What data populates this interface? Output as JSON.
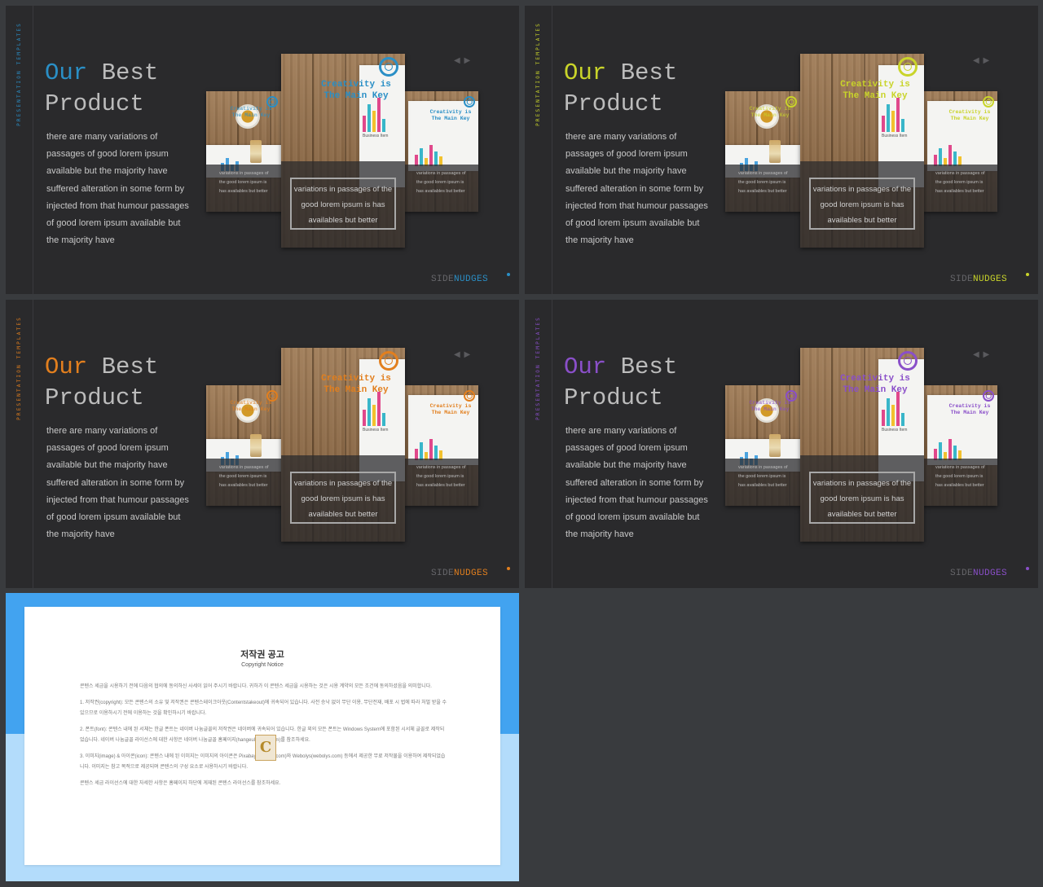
{
  "slides": [
    {
      "accent": "#2a8fc6",
      "vertical_label": "PRESENTATION TEMPLATES",
      "title_word1": "Our",
      "title_word2": "Best",
      "title_word3": "Product",
      "body": "there are many variations of passages of good lorem ipsum available but the majority have suffered alteration in some form by injected from that humour passages of good lorem ipsum available but the majority have",
      "nav_arrows": "◀ ▶",
      "center_heading": "Creativity is The Main Key",
      "side_heading": "Creativity is The Main Key",
      "center_caption": "variations in passages of the good lorem ipsum  is has availables but better",
      "side_caption": "variations in passages of the good lorem ipsum  is has availables but better",
      "paper_label": "Business Item",
      "brand_side": "SIDE",
      "brand_nudges": "NUDGES",
      "icons": [
        "target-ring-icon",
        "coffee-cup-icon",
        "bar-chart-icon",
        "left-arrow-icon",
        "right-arrow-icon"
      ]
    },
    {
      "accent": "#c9d42a",
      "vertical_label": "PRESENTATION TEMPLATES",
      "title_word1": "Our",
      "title_word2": "Best",
      "title_word3": "Product",
      "body": "there are many variations of passages of good lorem ipsum available but the majority have suffered alteration in some form by injected from that humour passages of good lorem ipsum available but the majority have",
      "nav_arrows": "◀ ▶",
      "center_heading": "Creativity is The Main Key",
      "side_heading": "Creativity is The Main Key",
      "center_caption": "variations in passages of the good lorem ipsum  is has availables but better",
      "side_caption": "variations in passages of the good lorem ipsum  is has availables but better",
      "paper_label": "Business Item",
      "brand_side": "SIDE",
      "brand_nudges": "NUDGES"
    },
    {
      "accent": "#e27f1e",
      "vertical_label": "PRESENTATION TEMPLATES",
      "title_word1": "Our",
      "title_word2": "Best",
      "title_word3": "Product",
      "body": "there are many variations of passages of good lorem ipsum available but the majority have suffered alteration in some form by injected from that humour passages of good lorem ipsum available but the majority have",
      "nav_arrows": "◀ ▶",
      "center_heading": "Creativity is The Main Key",
      "side_heading": "Creativity is The Main Key",
      "center_caption": "variations in passages of the good lorem ipsum  is has availables but better",
      "side_caption": "variations in passages of the good lorem ipsum  is has availables but better",
      "paper_label": "Business Item",
      "brand_side": "SIDE",
      "brand_nudges": "NUDGES"
    },
    {
      "accent": "#8a4fc9",
      "vertical_label": "PRESENTATION TEMPLATES",
      "title_word1": "Our",
      "title_word2": "Best",
      "title_word3": "Product",
      "body": "there are many variations of passages of good lorem ipsum available but the majority have suffered alteration in some form by injected from that humour passages of good lorem ipsum available but the majority have",
      "nav_arrows": "◀ ▶",
      "center_heading": "Creativity is The Main Key",
      "side_heading": "Creativity is The Main Key",
      "center_caption": "variations in passages of the good lorem ipsum  is has availables but better",
      "side_caption": "variations in passages of the good lorem ipsum  is has availables but better",
      "paper_label": "Business Item",
      "brand_side": "SIDE",
      "brand_nudges": "NUDGES"
    }
  ],
  "copyright": {
    "title": "저작권 공고",
    "subtitle": "Copyright Notice",
    "paragraphs": [
      "콘텐스 세금을 시용하기 전에 다음의 협의에 동의하신 사세이 읽어 주시기 바랍니다. 귀하가 이 콘텐스 세금을 시용하는 것은 시용 계약의 모든 조건에 동의하셨음을 의미합니다.",
      "1. 저작권(copyright): 모든 콘텐스의 소유 및 저작권은 콘텐스테이크아웃(Contentstakeout)에 귀속되어 있습니다. 사전 승낙 없이 무단 이용, 무단전재, 배포 시 법에 따라 처벌 받을 수 있으므로 이용하시기 전에 이용하는 것을 확인하시기 바랍니다.",
      "2. 폰트(font): 콘텐스 내에 된 서체는 한글 폰트는 네이버 나눔글꼴의 저작권은 네이버에 귀속되어 있습니다. 한글 외의 모든 폰트는 Windows System에 포함된 시서체 글꼴로 제작되었습니다. 네이버 나눔글꼴 라이선스에 대한 사항은 네이버 나눔글꼴 홈페이지(hangeul.naver.com)를 참조하세요.",
      "3. 이미지(image) & 아이콘(icon): 콘텐스 내에 된 이미지는 이미지의 아이콘은 Pixabay(pixabay.com)와 Webolys(webolys.com) 등에서 제공한 무료 저작물을 이용하여 제작되었습니다. 이미지는 참고 목적으로 제공되며 콘텐스의 구성 요소로 사용하시기 바랍니다.",
      "콘텐스 세금 라이선스에 대한 자세한 사항은 홈페이지 하단에 게재된 콘텐스 라이선스를 참조하세요."
    ],
    "logo_letter": "C"
  }
}
